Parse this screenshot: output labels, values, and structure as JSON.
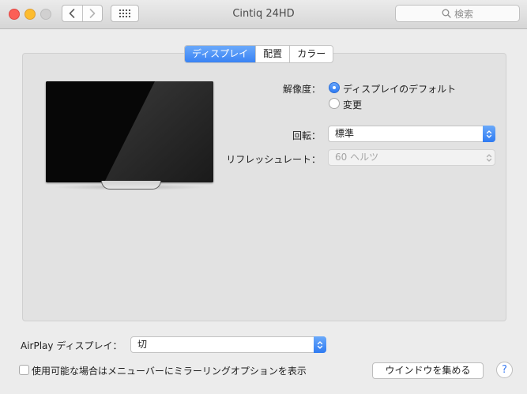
{
  "window": {
    "title": "Cintiq 24HD",
    "search_placeholder": "検索"
  },
  "tabs": [
    {
      "label": "ディスプレイ",
      "active": true
    },
    {
      "label": "配置",
      "active": false
    },
    {
      "label": "カラー",
      "active": false
    }
  ],
  "display": {
    "resolution_label": "解像度：",
    "resolution_options": [
      {
        "label": "ディスプレイのデフォルト",
        "selected": true
      },
      {
        "label": "変更",
        "selected": false
      }
    ],
    "rotation_label": "回転：",
    "rotation_value": "標準",
    "refresh_label": "リフレッシュレート：",
    "refresh_value": "60 ヘルツ"
  },
  "footer": {
    "airplay_label": "AirPlay ディスプレイ：",
    "airplay_value": "切",
    "mirroring_checkbox_label": "使用可能な場合はメニューバーにミラーリングオプションを表示",
    "mirroring_checked": false,
    "gather_windows_button": "ウインドウを集める",
    "help_glyph": "?"
  },
  "icons": {
    "back": "chevron-left-icon",
    "forward": "chevron-right-icon",
    "grid": "grid-icon",
    "search": "search-icon",
    "help": "help-icon"
  },
  "colors": {
    "accent": "#3a83f4",
    "close": "#fc5f57",
    "minimize": "#fdbc2e",
    "zoom_inactive": "#d1d0d0"
  }
}
